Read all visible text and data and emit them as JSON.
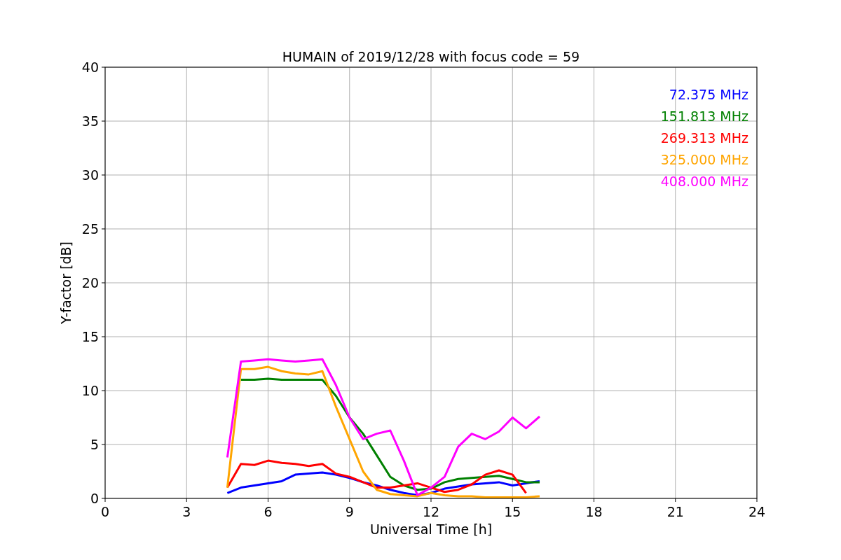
{
  "chart_data": {
    "type": "line",
    "title": "HUMAIN of 2019/12/28 with focus code = 59",
    "xlabel": "Universal Time [h]",
    "ylabel": "Y-factor [dB]",
    "x": [
      4.5,
      5,
      5.5,
      6,
      6.5,
      7,
      7.5,
      8,
      8.5,
      9,
      9.5,
      10,
      10.5,
      11,
      11.5,
      12,
      12.5,
      13,
      13.5,
      14,
      14.5,
      15,
      15.5,
      16
    ],
    "series": [
      {
        "name": "72.375 MHz",
        "color": "#0000ff",
        "values": [
          0.5,
          1.0,
          1.2,
          1.4,
          1.6,
          2.2,
          2.3,
          2.4,
          2.2,
          1.9,
          1.5,
          1.2,
          0.8,
          0.5,
          0.3,
          0.5,
          0.9,
          1.1,
          1.3,
          1.4,
          1.5,
          1.2,
          1.4,
          1.6
        ]
      },
      {
        "name": "151.813 MHz",
        "color": "#008000",
        "values": [
          null,
          11.0,
          11.0,
          11.1,
          11.0,
          11.0,
          11.0,
          11.0,
          9.5,
          7.5,
          6.0,
          4.0,
          2.0,
          1.2,
          0.8,
          0.9,
          1.5,
          1.8,
          1.9,
          2.0,
          2.1,
          1.8,
          1.5,
          1.5
        ]
      },
      {
        "name": "269.313 MHz",
        "color": "#ff0000",
        "values": [
          1.0,
          3.2,
          3.1,
          3.5,
          3.3,
          3.2,
          3.0,
          3.2,
          2.3,
          2.0,
          1.5,
          1.0,
          1.0,
          1.2,
          1.4,
          1.0,
          0.6,
          0.8,
          1.3,
          2.2,
          2.6,
          2.2,
          0.5,
          null
        ]
      },
      {
        "name": "325.000 MHz",
        "color": "#ffa500",
        "values": [
          1.0,
          12.0,
          12.0,
          12.2,
          11.8,
          11.6,
          11.5,
          11.8,
          8.5,
          5.5,
          2.5,
          0.8,
          0.4,
          0.3,
          0.2,
          0.5,
          0.3,
          0.2,
          0.2,
          0.1,
          0.1,
          0.1,
          0.1,
          0.2
        ]
      },
      {
        "name": "408.000 MHz",
        "color": "#ff00ff",
        "values": [
          3.8,
          12.7,
          12.8,
          12.9,
          12.8,
          12.7,
          12.8,
          12.9,
          10.5,
          7.5,
          5.5,
          6.0,
          6.3,
          3.5,
          0.3,
          1.0,
          2.0,
          4.8,
          6.0,
          5.5,
          6.2,
          7.5,
          6.5,
          7.6
        ]
      }
    ],
    "xlim": [
      0,
      24
    ],
    "ylim": [
      0,
      40
    ],
    "xticks": [
      0,
      3,
      6,
      9,
      12,
      15,
      18,
      21,
      24
    ],
    "yticks": [
      0,
      5,
      10,
      15,
      20,
      25,
      30,
      35,
      40
    ],
    "grid": true
  }
}
